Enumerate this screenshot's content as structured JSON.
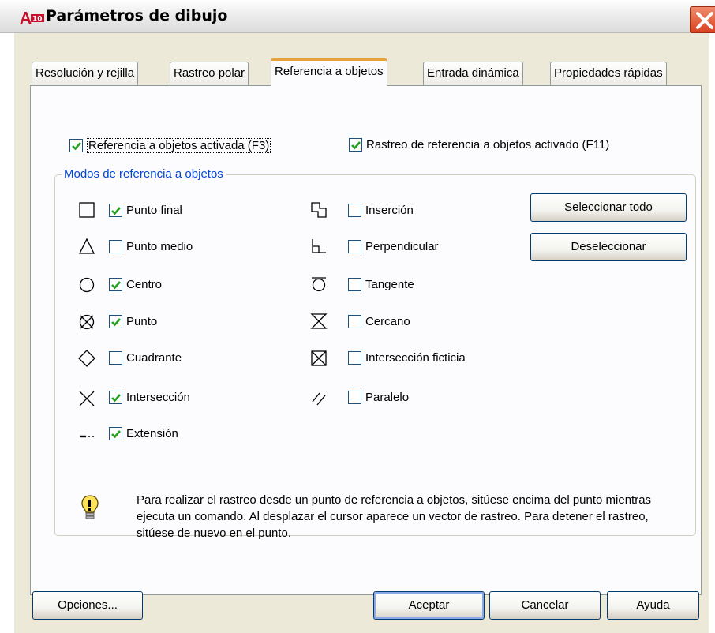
{
  "window": {
    "title": "Parámetros de dibujo",
    "icon": "autocad-app-icon",
    "close_icon": "close-icon"
  },
  "tabs": [
    {
      "label": "Resolución y rejilla",
      "active": false
    },
    {
      "label": "Rastreo polar",
      "active": false
    },
    {
      "label": "Referencia a objetos",
      "active": true
    },
    {
      "label": "Entrada dinámica",
      "active": false
    },
    {
      "label": "Propiedades rápidas",
      "active": false
    }
  ],
  "top_options": {
    "osnap_on": {
      "label": "Referencia a objetos activada (F3)",
      "checked": true
    },
    "otrack_on": {
      "label": "Rastreo de referencia a objetos activado (F11)",
      "checked": true
    }
  },
  "group": {
    "title": "Modos de referencia a objetos",
    "left_column": [
      {
        "icon": "endpoint-square-icon",
        "label": "Punto final",
        "checked": true
      },
      {
        "icon": "midpoint-triangle-icon",
        "label": "Punto medio",
        "checked": false
      },
      {
        "icon": "center-circle-icon",
        "label": "Centro",
        "checked": true
      },
      {
        "icon": "node-circle-x-icon",
        "label": "Punto",
        "checked": true
      },
      {
        "icon": "quadrant-diamond-icon",
        "label": "Cuadrante",
        "checked": false
      },
      {
        "icon": "intersection-x-icon",
        "label": "Intersección",
        "checked": true
      },
      {
        "icon": "extension-dashes-icon",
        "label": "Extensión",
        "checked": true
      }
    ],
    "right_column": [
      {
        "icon": "insertion-icon",
        "label": "Inserción",
        "checked": false
      },
      {
        "icon": "perpendicular-icon",
        "label": "Perpendicular",
        "checked": false
      },
      {
        "icon": "tangent-icon",
        "label": "Tangente",
        "checked": false
      },
      {
        "icon": "nearest-hourglass-icon",
        "label": "Cercano",
        "checked": false
      },
      {
        "icon": "apparent-intersection-icon",
        "label": "Intersección ficticia",
        "checked": false
      },
      {
        "icon": "parallel-icon",
        "label": "Paralelo",
        "checked": false
      }
    ],
    "buttons": {
      "select_all": "Seleccionar todo",
      "clear_all": "Deseleccionar"
    },
    "tip": {
      "icon": "lightbulb-icon",
      "text": "Para realizar el rastreo desde un punto de referencia a objetos, sitúese encima del punto mientras ejecuta un comando. Al desplazar el cursor aparece un vector de rastreo. Para detener el rastreo, sitúese de nuevo en el punto."
    }
  },
  "footer": {
    "options": "Opciones...",
    "ok": "Aceptar",
    "cancel": "Cancelar",
    "help": "Ayuda"
  },
  "colors": {
    "accent_tab": "#e8a23c",
    "check_green": "#21a121",
    "group_title": "#0046d5",
    "button_border": "#003c74"
  }
}
